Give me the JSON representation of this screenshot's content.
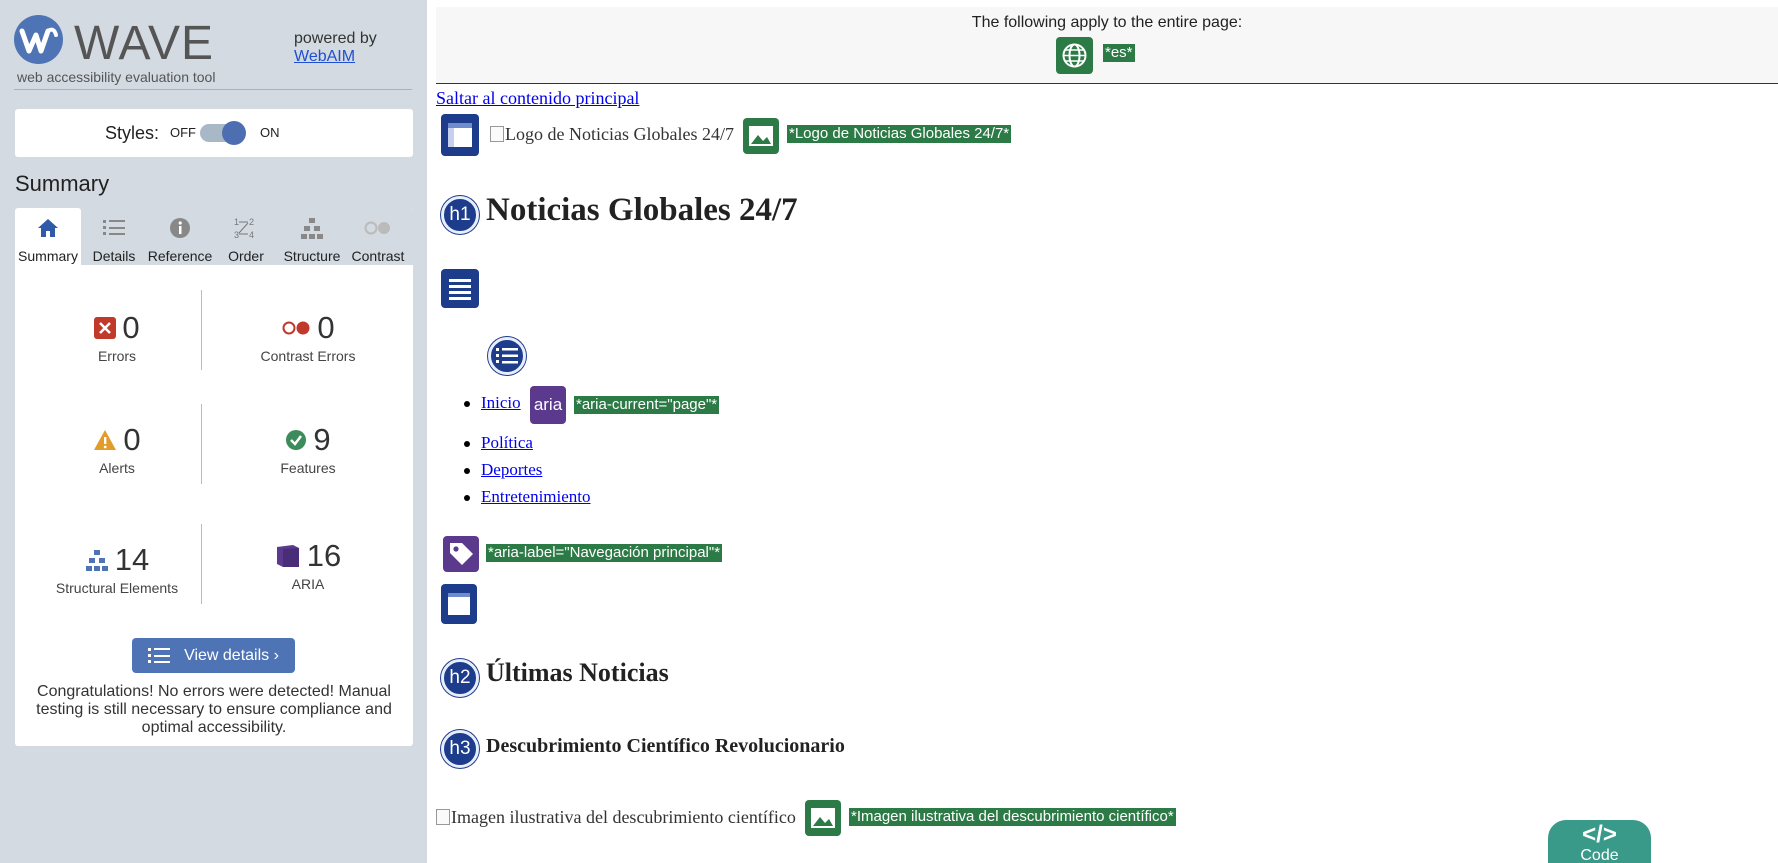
{
  "app": {
    "logo_text": "WAVE",
    "tagline": "web accessibility evaluation tool",
    "powered_by": "powered by",
    "powered_link": "WebAIM"
  },
  "styles_toggle": {
    "label": "Styles:",
    "off": "OFF",
    "on": "ON",
    "state": "on"
  },
  "summary_heading": "Summary",
  "tabs": [
    {
      "label": "Summary",
      "icon": "home-icon",
      "active": true
    },
    {
      "label": "Details",
      "icon": "list-icon",
      "active": false
    },
    {
      "label": "Reference",
      "icon": "info-icon",
      "active": false
    },
    {
      "label": "Order",
      "icon": "order-icon",
      "active": false
    },
    {
      "label": "Structure",
      "icon": "structure-icon",
      "active": false
    },
    {
      "label": "Contrast",
      "icon": "contrast-icon",
      "active": false
    }
  ],
  "stats": {
    "errors": {
      "count": "0",
      "label": "Errors"
    },
    "contrast": {
      "count": "0",
      "label": "Contrast Errors"
    },
    "alerts": {
      "count": "0",
      "label": "Alerts"
    },
    "features": {
      "count": "9",
      "label": "Features"
    },
    "structural": {
      "count": "14",
      "label": "Structural Elements"
    },
    "aria": {
      "count": "16",
      "label": "ARIA"
    }
  },
  "view_details_label": "View details ›",
  "congrats": "Congratulations! No errors were detected! Manual testing is still necessary to ensure compliance and optimal accessibility.",
  "colors": {
    "brand_blue": "#4f74b5",
    "feature_green": "#2c7a45",
    "structure_navy": "#1e3c8c",
    "aria_purple": "#5b3a8e",
    "code_teal": "#3a9a8a"
  },
  "preview": {
    "banner_text": "The following apply to the entire page:",
    "lang_tag": "*es*",
    "skip_link": "Saltar al contenido principal",
    "logo_alt": "Logo de Noticias Globales 24/7",
    "logo_tag": "*Logo de Noticias Globales 24/7*",
    "h1_badge": "h1",
    "h1": "Noticias Globales 24/7",
    "nav_items": [
      "Inicio",
      "Política",
      "Deportes",
      "Entretenimiento"
    ],
    "aria_badge": "aria",
    "aria_current_tag": "*aria-current=\"page\"*",
    "aria_label_tag": "*aria-label=\"Navegación principal\"*",
    "h2_badge": "h2",
    "h2": "Últimas Noticias",
    "h3_badge": "h3",
    "h3": "Descubrimiento Científico Revolucionario",
    "img_alt": "Imagen ilustrativa del descubrimiento científico",
    "img_tag": "*Imagen ilustrativa del descubrimiento científico*",
    "code_label": "Code",
    "code_glyph": "</>"
  }
}
